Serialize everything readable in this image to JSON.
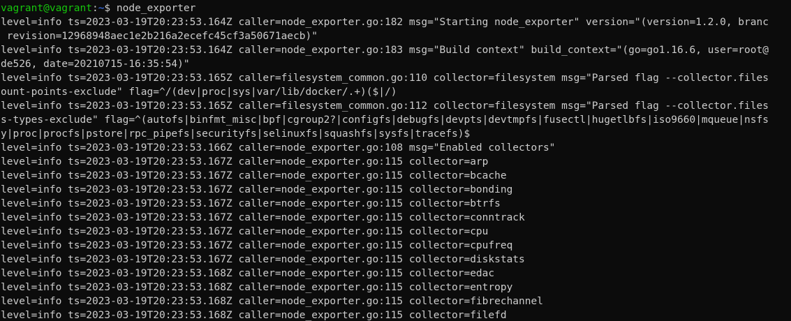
{
  "prompt": {
    "user_host": "vagrant@vagrant",
    "separator": ":",
    "path": "~",
    "symbol": "$ ",
    "command": "node_exporter"
  },
  "output_lines": [
    "level=info ts=2023-03-19T20:23:53.164Z caller=node_exporter.go:182 msg=\"Starting node_exporter\" version=\"(version=1.2.0, branc",
    " revision=12968948aec1e2b216a2ecefc45cf3a50671aecb)\"",
    "level=info ts=2023-03-19T20:23:53.164Z caller=node_exporter.go:183 msg=\"Build context\" build_context=\"(go=go1.16.6, user=root@",
    "de526, date=20210715-16:35:54)\"",
    "level=info ts=2023-03-19T20:23:53.165Z caller=filesystem_common.go:110 collector=filesystem msg=\"Parsed flag --collector.files",
    "ount-points-exclude\" flag=^/(dev|proc|sys|var/lib/docker/.+)($|/)",
    "level=info ts=2023-03-19T20:23:53.165Z caller=filesystem_common.go:112 collector=filesystem msg=\"Parsed flag --collector.files",
    "s-types-exclude\" flag=^(autofs|binfmt_misc|bpf|cgroup2?|configfs|debugfs|devpts|devtmpfs|fusectl|hugetlbfs|iso9660|mqueue|nsfs",
    "y|proc|procfs|pstore|rpc_pipefs|securityfs|selinuxfs|squashfs|sysfs|tracefs)$",
    "level=info ts=2023-03-19T20:23:53.166Z caller=node_exporter.go:108 msg=\"Enabled collectors\"",
    "level=info ts=2023-03-19T20:23:53.167Z caller=node_exporter.go:115 collector=arp",
    "level=info ts=2023-03-19T20:23:53.167Z caller=node_exporter.go:115 collector=bcache",
    "level=info ts=2023-03-19T20:23:53.167Z caller=node_exporter.go:115 collector=bonding",
    "level=info ts=2023-03-19T20:23:53.167Z caller=node_exporter.go:115 collector=btrfs",
    "level=info ts=2023-03-19T20:23:53.167Z caller=node_exporter.go:115 collector=conntrack",
    "level=info ts=2023-03-19T20:23:53.167Z caller=node_exporter.go:115 collector=cpu",
    "level=info ts=2023-03-19T20:23:53.167Z caller=node_exporter.go:115 collector=cpufreq",
    "level=info ts=2023-03-19T20:23:53.167Z caller=node_exporter.go:115 collector=diskstats",
    "level=info ts=2023-03-19T20:23:53.168Z caller=node_exporter.go:115 collector=edac",
    "level=info ts=2023-03-19T20:23:53.168Z caller=node_exporter.go:115 collector=entropy",
    "level=info ts=2023-03-19T20:23:53.168Z caller=node_exporter.go:115 collector=fibrechannel",
    "level=info ts=2023-03-19T20:23:53.168Z caller=node_exporter.go:115 collector=filefd"
  ],
  "colors": {
    "background": "#0c0c0c",
    "foreground": "#cccccc",
    "prompt_user": "#16c60c",
    "prompt_path": "#3b78ff"
  }
}
